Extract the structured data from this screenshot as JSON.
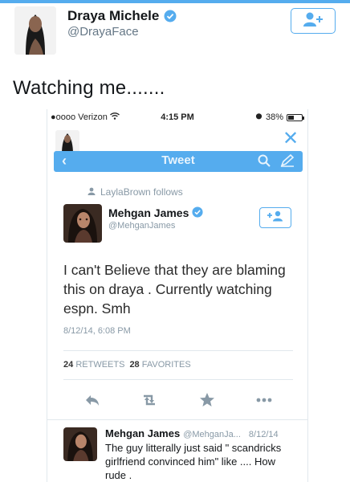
{
  "outer_tweet": {
    "name": "Draya Michele",
    "handle": "@DrayaFace",
    "text": "Watching me......."
  },
  "phone": {
    "status_bar": {
      "carrier": "●oooo Verizon",
      "time": "4:15 PM",
      "battery": "38%",
      "battery_level": 0.38
    },
    "nav": {
      "title": "Tweet"
    },
    "follows_line": "LaylaBrown follows",
    "tweet": {
      "name": "Mehgan James",
      "handle": "@MehganJames",
      "text": "I can't Believe that they are blaming this on draya . Currently watching espn. Smh",
      "date": "8/12/14, 6:08 PM",
      "retweets_count": "24",
      "retweets_label": "RETWEETS",
      "favorites_count": "28",
      "favorites_label": "FAVORITES"
    },
    "reply": {
      "name": "Mehgan James",
      "handle": "@MehganJa...",
      "date": "8/12/14",
      "text": "The guy litterally just said \" scandricks girlfriend convinced him\" like .... How rude ."
    }
  },
  "colors": {
    "accent": "#55acee",
    "muted": "#8899a6"
  }
}
